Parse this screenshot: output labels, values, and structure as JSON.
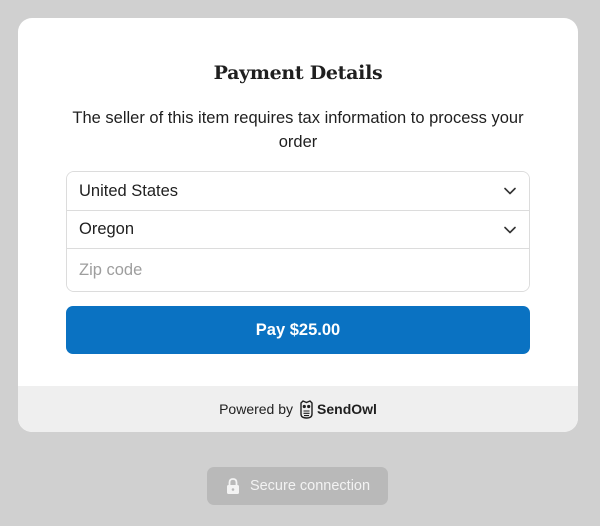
{
  "modal": {
    "title": "Payment Details",
    "info_text": "The seller of this item requires tax information to process your order",
    "country": {
      "value": "United States",
      "icon": "chevron-down-icon"
    },
    "state": {
      "value": "Oregon",
      "icon": "chevron-down-icon"
    },
    "zip": {
      "value": "",
      "placeholder": "Zip code"
    },
    "pay_button_label": "Pay $25.00",
    "footer": {
      "powered_by": "Powered by",
      "brand": "SendOwl",
      "icon": "owl-logo-icon"
    }
  },
  "secure_badge": {
    "label": "Secure connection",
    "icon": "lock-icon"
  },
  "colors": {
    "page_background": "#d0d0d0",
    "accent": "#0a72c2",
    "footer_background": "#efefef",
    "secure_badge_background": "#b9b9b9"
  }
}
